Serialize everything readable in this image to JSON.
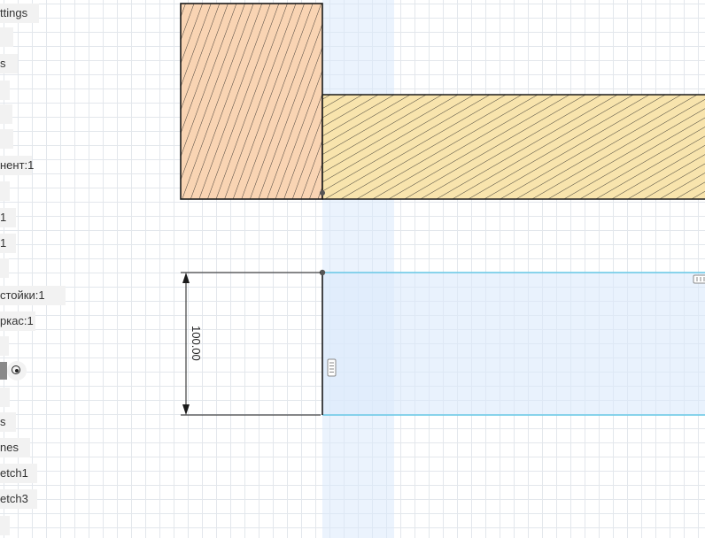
{
  "browser": {
    "rows": [
      {
        "label": "ttings"
      },
      {
        "label": ""
      },
      {
        "label": "s"
      },
      {
        "label": ""
      },
      {
        "label": ""
      },
      {
        "label": ""
      },
      {
        "label": "нент:1"
      },
      {
        "label": ""
      },
      {
        "label": "1"
      },
      {
        "label": "1"
      },
      {
        "label": ""
      },
      {
        "label": "стойки:1"
      },
      {
        "label": "ркас:1"
      },
      {
        "label": ""
      },
      {
        "label": ""
      },
      {
        "label": ""
      },
      {
        "label": "s"
      },
      {
        "label": "nes"
      },
      {
        "label": "etch1"
      },
      {
        "label": "etch3"
      },
      {
        "label": ""
      }
    ]
  },
  "sketch": {
    "dimension_value": "100.00",
    "colors": {
      "profile_left_fill": "#f9d4b3",
      "profile_right_fill": "#f8e4ad",
      "selection_fill": "#dbeafb",
      "selection_edge": "#67c8e6",
      "line": "#1a1a1a",
      "grid": "#e3e7ec"
    },
    "icons": [
      "dimension-constraint-icon",
      "horizontal-constraint-icon",
      "vertical-constraint-icon",
      "sketch-point-icon"
    ]
  }
}
